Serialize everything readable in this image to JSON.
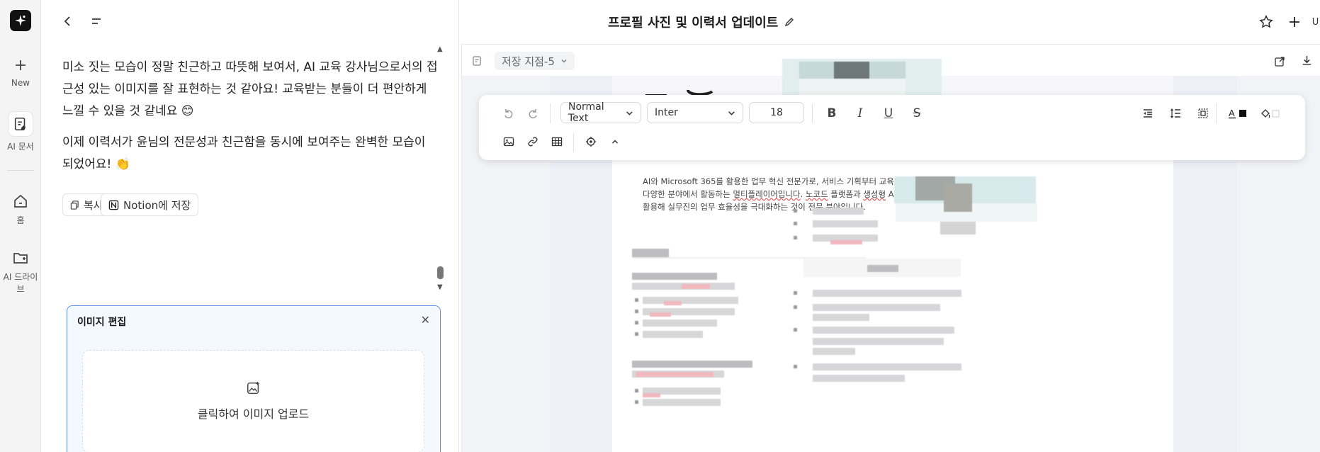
{
  "rail": {
    "new_label": "New",
    "ai_doc_label": "AI 문서",
    "home_label": "홈",
    "drive_label": "AI 드라이브"
  },
  "header": {
    "title": "프로필 사진 및 이력서 업데이트",
    "right_partial": "U"
  },
  "chat": {
    "message1": "미소 짓는 모습이 정말 친근하고 따뜻해 보여서, AI 교육 강사님으로서의 접근성 있는 이미지를 잘 표현하는 것 같아요! 교육받는 분들이 더 편안하게 느낄 수 있을 것 같네요 😊",
    "message2": "이제 이력서가 윤님의 전문성과 친근함을 동시에 보여주는 완벽한 모습이 되었어요! 👏",
    "copy_label": "복사",
    "notion_label": "Notion에 저장"
  },
  "image_edit": {
    "title": "이미지 편집",
    "upload_text": "클릭하여 이미지 업로드"
  },
  "editor": {
    "save_point": "저장 지점-5",
    "block_type": "Normal Text",
    "font": "Inter",
    "font_size": "18",
    "intro_line1": "AI와 Microsoft 365를 활용한 업무 혁신 전문가로, 서비스 기획부터 교육까지",
    "intro_line2a": "다양한 분야에서 활동하는 ",
    "intro_line2b": "멀티플레이어입니다",
    "intro_line2c": ". ",
    "intro_line2d": "노코드",
    "intro_line2e": " 플랫폼과 ",
    "intro_line2f": "생성형",
    "intro_line2g": " AI를",
    "intro_line3": "활용해 실무진의 업무 효율성을 극대화하는 것이 전문 분야입니다."
  },
  "colors": {
    "accent_blue": "#5f8ef0",
    "spell_red": "#e05a5a"
  }
}
